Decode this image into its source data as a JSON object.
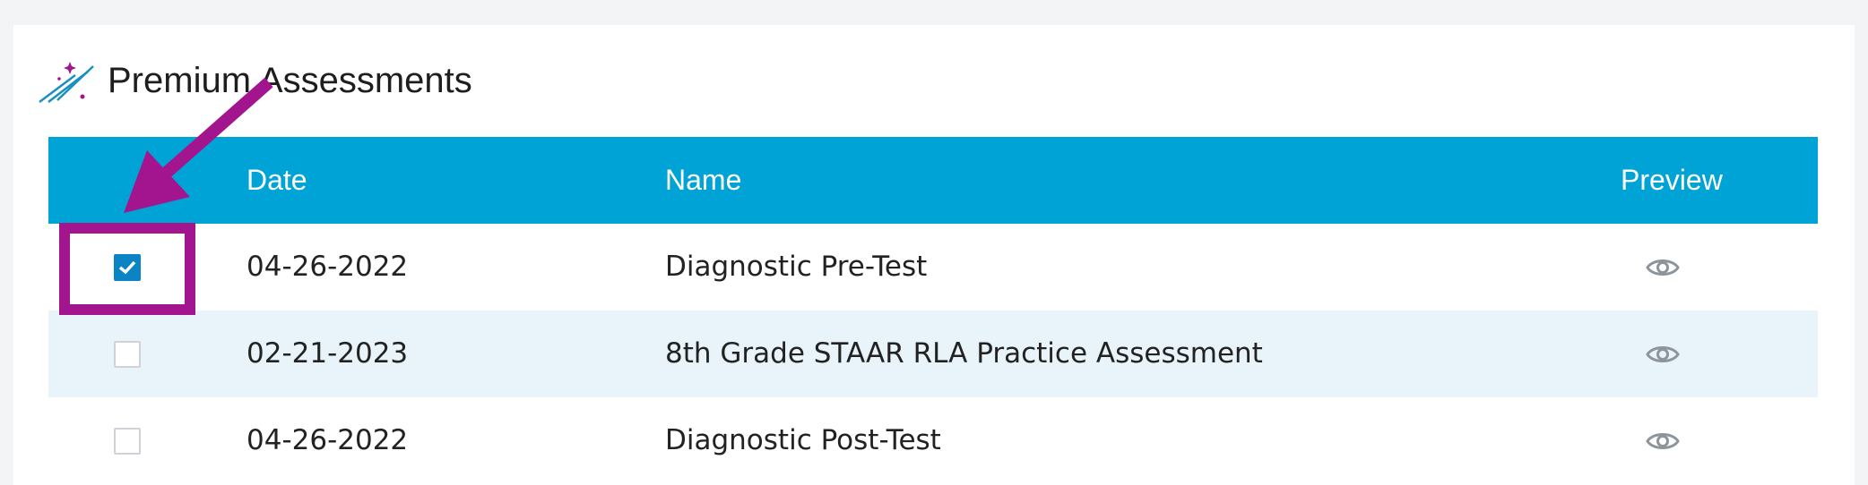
{
  "page": {
    "title": "Premium Assessments"
  },
  "table": {
    "headers": {
      "date": "Date",
      "name": "Name",
      "preview": "Preview"
    },
    "rows": [
      {
        "date": "04-26-2022",
        "name": "Diagnostic Pre-Test",
        "checked": true
      },
      {
        "date": "02-21-2023",
        "name": "8th Grade STAAR RLA Practice Assessment",
        "checked": false
      },
      {
        "date": "04-26-2022",
        "name": "Diagnostic Post-Test",
        "checked": false
      }
    ]
  },
  "icons": {
    "logo": "shooting-stars-icon",
    "preview": "eye-icon",
    "check": "checkmark-icon"
  },
  "colors": {
    "header_bg": "#00a3d6",
    "alt_row_bg": "#e8f4f9",
    "checkbox_checked": "#0a84c4",
    "annotation": "#a3148f"
  }
}
